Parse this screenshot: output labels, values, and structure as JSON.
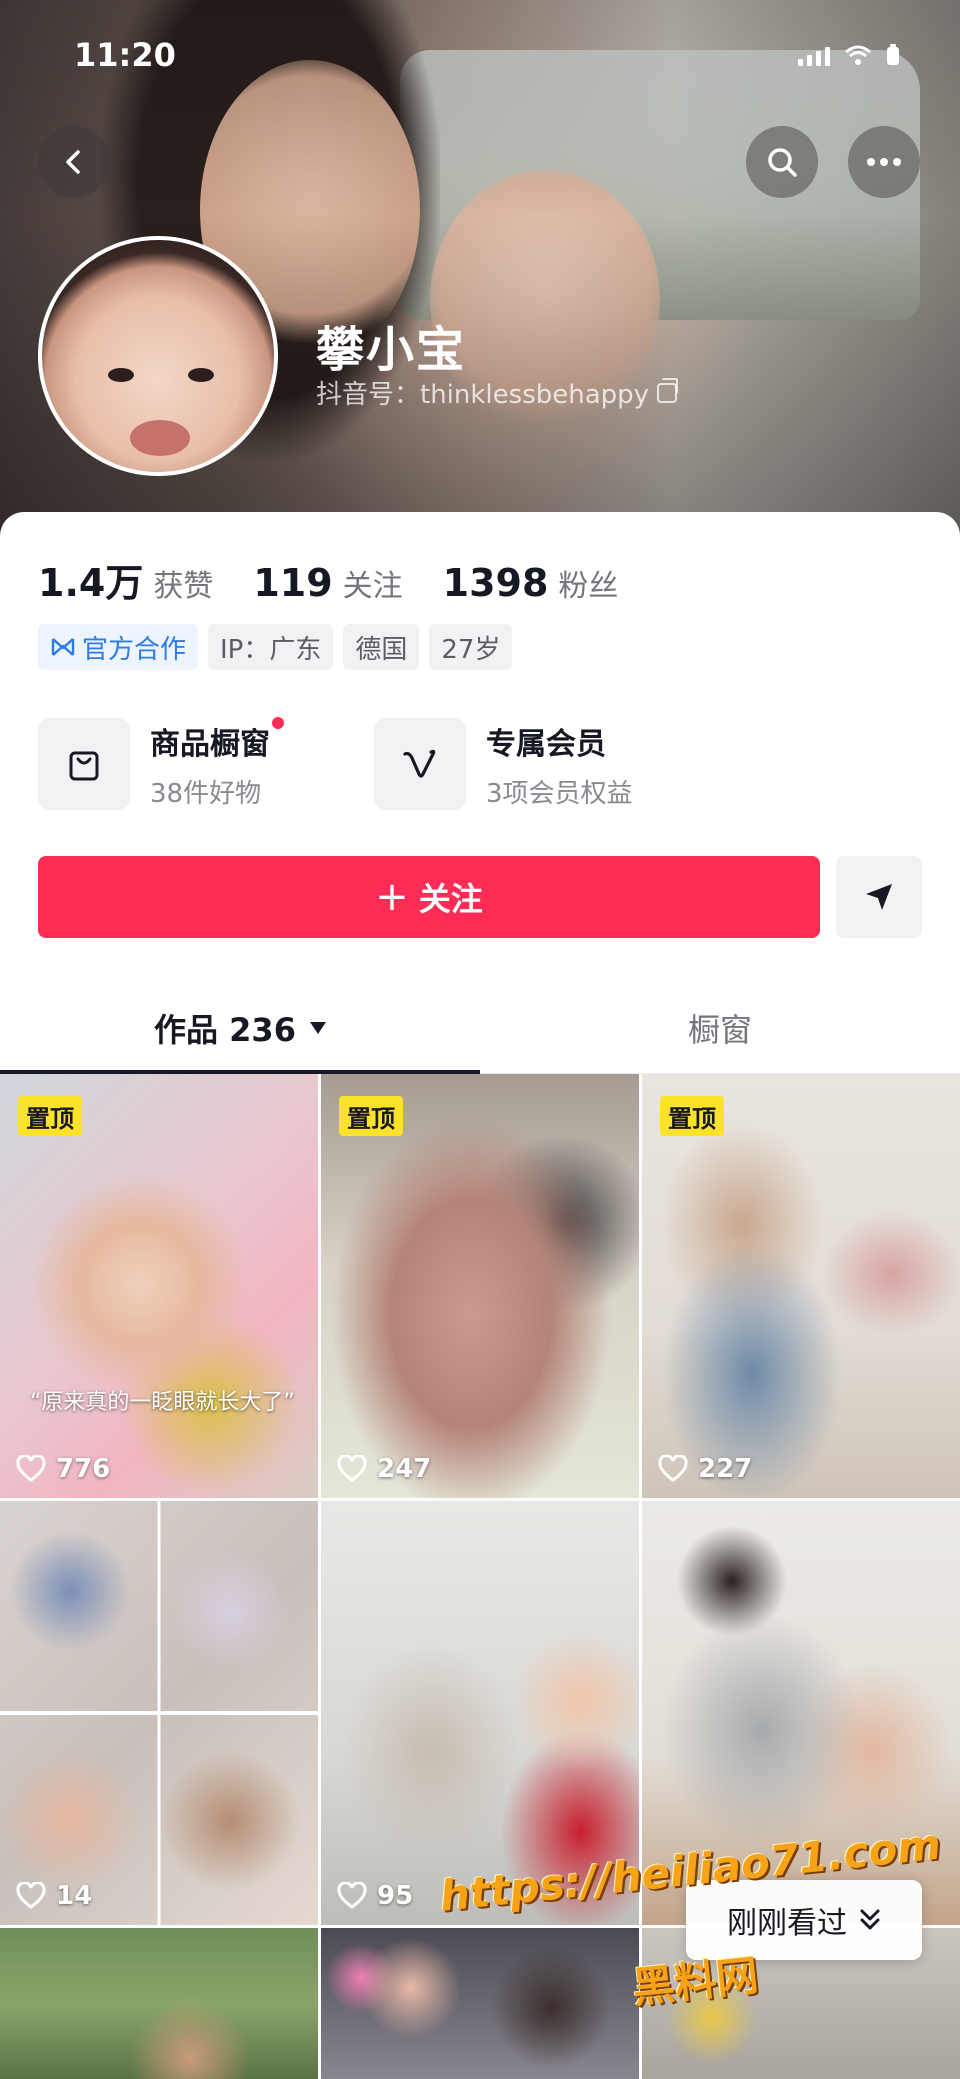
{
  "status_bar": {
    "time": "11:20"
  },
  "header": {
    "icons": [
      "back-arrow-icon",
      "search-icon",
      "more-icon"
    ]
  },
  "profile": {
    "name": "攀小宝",
    "douyin_id": "抖音号：thinklessbehappy"
  },
  "stats": [
    {
      "value": "1.4万",
      "label": "获赞"
    },
    {
      "value": "119",
      "label": "关注"
    },
    {
      "value": "1398",
      "label": "粉丝"
    }
  ],
  "tags": [
    {
      "label": "官方合作",
      "icon": "official-collab-icon",
      "color": "#2e7be8"
    },
    {
      "label": "IP：广东"
    },
    {
      "label": "德国"
    },
    {
      "label": "27岁"
    }
  ],
  "features": [
    {
      "title": "商品橱窗",
      "subtitle": "38件好物",
      "icon": "shopping-bag-icon",
      "has_red_dot": true
    },
    {
      "title": "专属会员",
      "subtitle": "3项会员权益",
      "icon": "membership-v-icon",
      "has_red_dot": false
    }
  ],
  "actions": {
    "follow_label": "关注",
    "follow_plus": "+",
    "follow_color": "#fe2c55",
    "share_icon": "send-arrow-icon"
  },
  "tabs": [
    {
      "label": "作品 236",
      "active": true,
      "has_dropdown": true
    },
    {
      "label": "橱窗",
      "active": false
    }
  ],
  "videos": [
    {
      "pinned": true,
      "pinned_label": "置顶",
      "likes": "776",
      "caption": "“原来真的一眨眼就长大了”"
    },
    {
      "pinned": true,
      "pinned_label": "置顶",
      "likes": "247"
    },
    {
      "pinned": true,
      "pinned_label": "置顶",
      "likes": "227"
    },
    {
      "pinned": false,
      "likes": "14"
    },
    {
      "pinned": false,
      "likes": "95"
    },
    {
      "pinned": false,
      "likes": ""
    },
    {
      "pinned": false,
      "likes": ""
    },
    {
      "pinned": false,
      "likes": ""
    },
    {
      "pinned": false,
      "likes": ""
    }
  ],
  "recently_watched": {
    "label": "刚刚看过",
    "icon": "double-chevron-down-icon"
  },
  "watermark": {
    "url": "https://heiliao71.com",
    "name": "黑料网"
  }
}
